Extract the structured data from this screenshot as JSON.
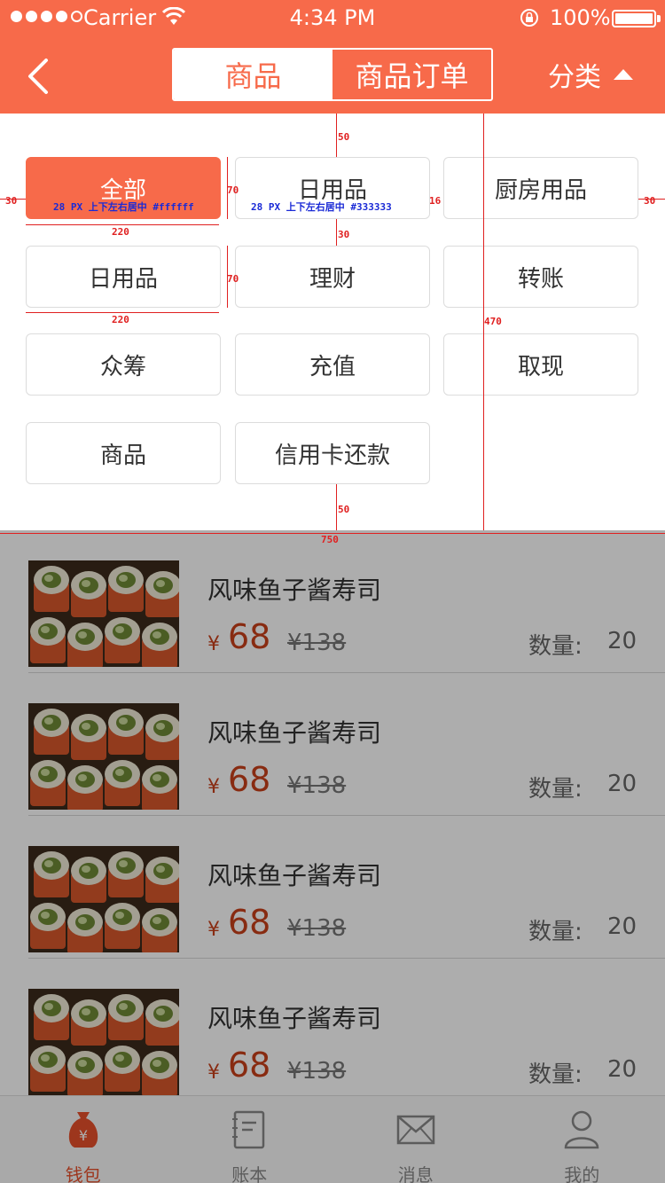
{
  "status": {
    "carrier": "Carrier",
    "time": "4:34 PM",
    "battery": "100%"
  },
  "nav": {
    "segments": [
      "商品",
      "商品订单"
    ],
    "category_label": "分类"
  },
  "categories": [
    "全部",
    "日用品",
    "厨房用品",
    "日用品",
    "理财",
    "转账",
    "众筹",
    "充值",
    "取现",
    "商品",
    "信用卡还款"
  ],
  "selected_category": "全部",
  "annotations": {
    "top_gap": "50",
    "left_gap": "30",
    "right_gap": "30",
    "chip_height": "70",
    "chip_height_2": "70",
    "chip_width": "220",
    "chip_width_2": "220",
    "col_gap": "16",
    "row_gap": "30",
    "bottom_gap": "50",
    "panel_height": "470",
    "screen_width": "750",
    "note_selected": "28 PX 上下左右居中 #ffffff",
    "note_normal": "28 PX 上下左右居中 #333333"
  },
  "products": [
    {
      "name": "风味鱼子酱寿司",
      "currency": "¥",
      "price": "68",
      "original": "¥138",
      "qty_label": "数量:",
      "qty": "20"
    },
    {
      "name": "风味鱼子酱寿司",
      "currency": "¥",
      "price": "68",
      "original": "¥138",
      "qty_label": "数量:",
      "qty": "20"
    },
    {
      "name": "风味鱼子酱寿司",
      "currency": "¥",
      "price": "68",
      "original": "¥138",
      "qty_label": "数量:",
      "qty": "20"
    },
    {
      "name": "风味鱼子酱寿司",
      "currency": "¥",
      "price": "68",
      "original": "¥138",
      "qty_label": "数量:",
      "qty": "20"
    }
  ],
  "tabs": [
    {
      "label": "钱包",
      "icon": "wallet-icon"
    },
    {
      "label": "账本",
      "icon": "notebook-icon"
    },
    {
      "label": "消息",
      "icon": "envelope-icon"
    },
    {
      "label": "我的",
      "icon": "user-icon"
    }
  ],
  "colors": {
    "accent": "#f76a4a",
    "price": "#c9401a",
    "text": "#333333",
    "selected_text": "#ffffff"
  }
}
